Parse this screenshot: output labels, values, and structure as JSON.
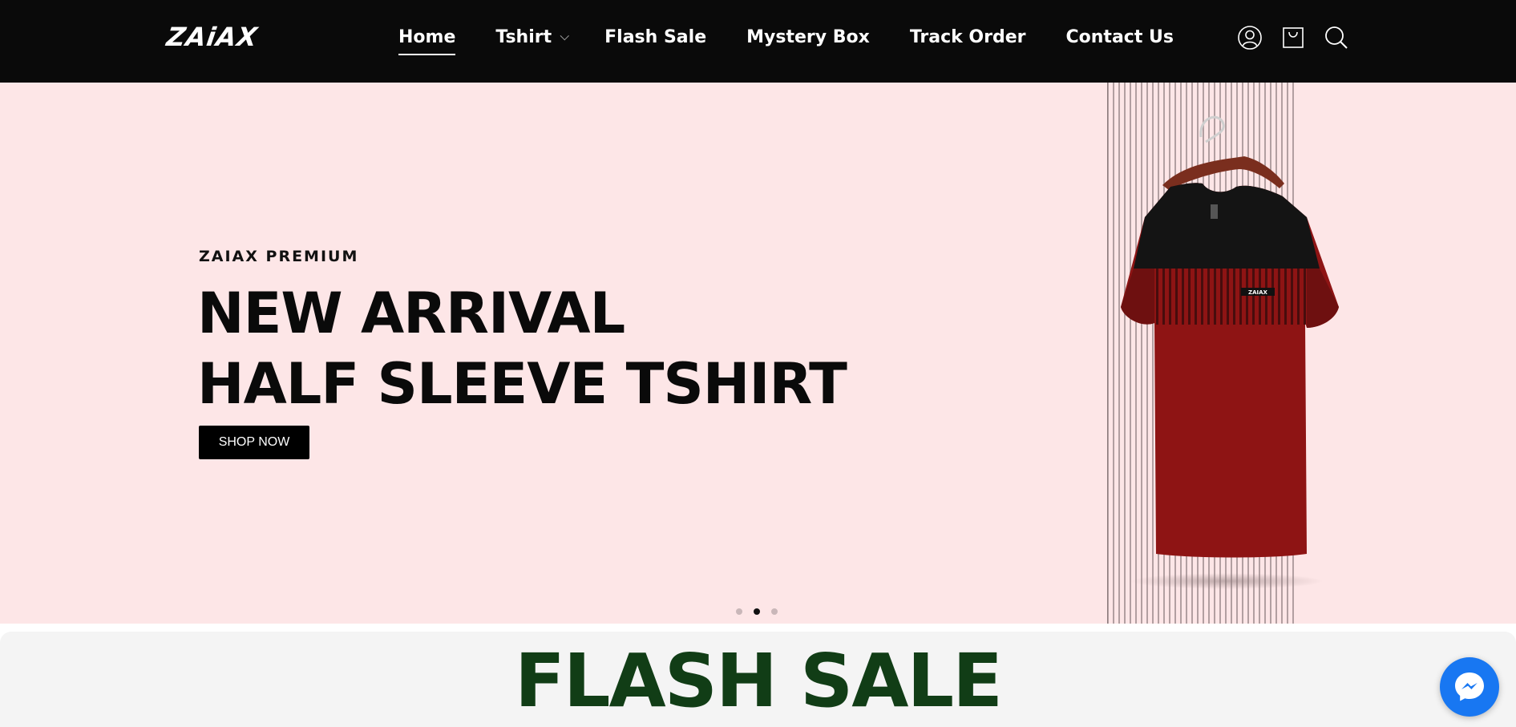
{
  "brand": {
    "logo_text": "ZAiAX"
  },
  "nav": {
    "items": [
      {
        "label": "Home",
        "active": true
      },
      {
        "label": "Tshirt",
        "has_dropdown": true
      },
      {
        "label": "Flash Sale"
      },
      {
        "label": "Mystery Box"
      },
      {
        "label": "Track Order"
      },
      {
        "label": "Contact Us"
      }
    ],
    "icons": [
      "user-icon",
      "cart-icon",
      "search-icon"
    ]
  },
  "hero": {
    "kicker": "ZAIAX PREMIUM",
    "headline_line1": "NEW ARRIVAL",
    "headline_line2": "HALF SLEEVE TSHIRT",
    "button_label": "SHOP NOW",
    "slides_total": 3,
    "active_slide": 2,
    "tshirt_badge": "ZAIAX"
  },
  "flash_sale": {
    "title": "FLASH SALE"
  },
  "colors": {
    "header_bg": "#0a0a0a",
    "hero_bg": "#fde6e7",
    "flash_title": "#113d16",
    "messenger": "#1877f2"
  },
  "chat": {
    "icon": "messenger-icon"
  }
}
